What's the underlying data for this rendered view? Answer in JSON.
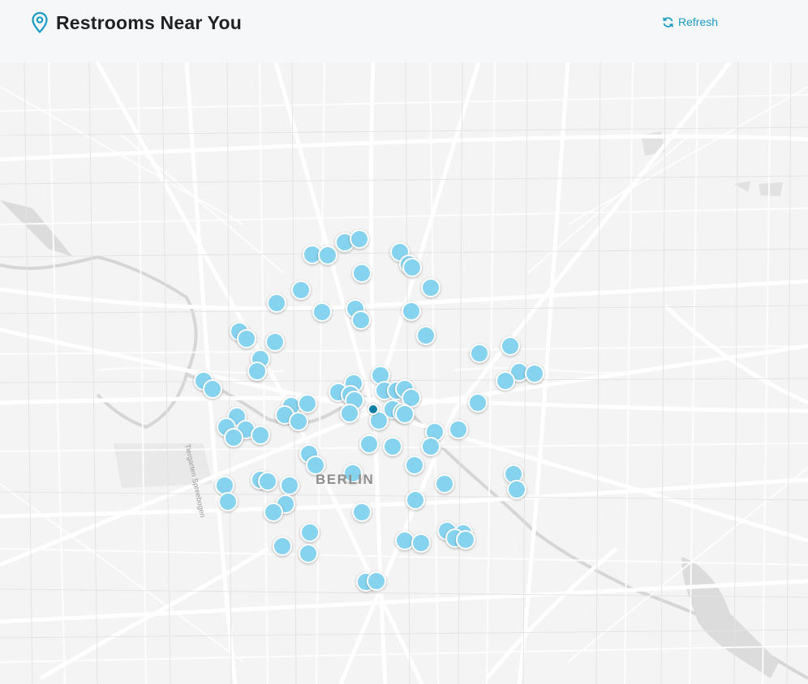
{
  "header": {
    "title": "Restrooms Near You",
    "refresh_label": "Refresh"
  },
  "icons": {
    "location": "map-pin-icon",
    "refresh": "refresh-icon"
  },
  "colors": {
    "accent": "#1a9bc4",
    "marker_fill": "#86d3f0",
    "user_location": "#0b7fa6"
  },
  "map": {
    "city_label": "BERLIN",
    "street_label": "Tiergarten Spreebogen",
    "restroom_count": 96
  }
}
